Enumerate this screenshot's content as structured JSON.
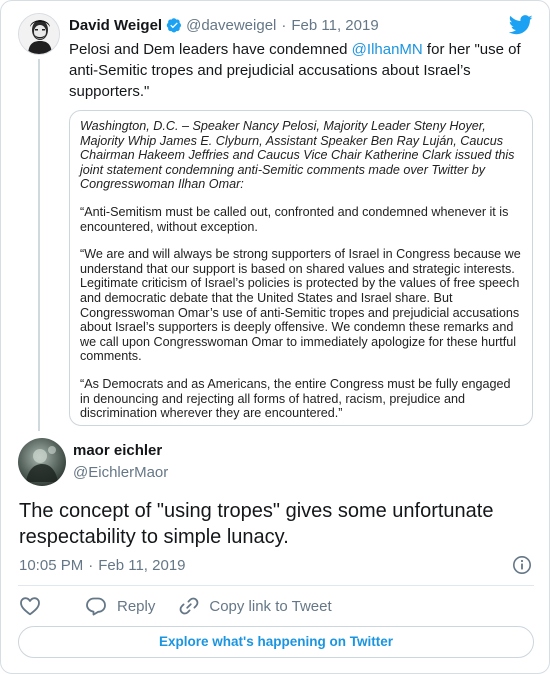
{
  "quoted_tweet": {
    "author_name": "David Weigel",
    "handle": "@daveweigel",
    "separator": "·",
    "date": "Feb 11, 2019",
    "text_before": "Pelosi and Dem leaders have condemned ",
    "mention": "@IlhanMN",
    "text_after": " for her \"use of anti-Semitic tropes and prejudicial accusations about Israel’s supporters.\"",
    "statement": {
      "lead": "Washington, D.C. – Speaker Nancy Pelosi, Majority Leader Steny Hoyer, Majority Whip James E. Clyburn, Assistant Speaker Ben Ray Luján, Caucus Chairman Hakeem Jeffries and Caucus Vice Chair Katherine Clark issued this joint statement condemning anti-Semitic comments made over Twitter by Congresswoman Ilhan Omar:",
      "p1": "“Anti-Semitism must be called out, confronted and condemned whenever it is encountered, without exception.",
      "p2": "“We are and will always be strong supporters of Israel in Congress because we understand that our support is based on shared values and strategic interests. Legitimate criticism of Israel’s policies is protected by the values of free speech and democratic debate that the United States and Israel share.  But Congresswoman Omar’s use of anti-Semitic tropes and prejudicial accusations about Israel’s supporters is deeply offensive.  We condemn these remarks and we call upon Congresswoman Omar to immediately apologize for these hurtful comments.",
      "p3": "“As Democrats and as Americans, the entire Congress must be fully engaged in denouncing and rejecting all forms of hatred, racism, prejudice and discrimination wherever they are encountered.”"
    }
  },
  "main_tweet": {
    "author_name": "maor eichler",
    "handle": "@EichlerMaor",
    "text": "The concept of \"using tropes\" gives some unfortunate respectability to simple lunacy.",
    "time": "10:05 PM",
    "separator": "·",
    "date": "Feb 11, 2019"
  },
  "actions": {
    "like_icon": "heart-icon",
    "reply_label": "Reply",
    "copy_link_label": "Copy link to Tweet"
  },
  "explore_label": "Explore what's happening on Twitter",
  "colors": {
    "accent": "#1b95e0",
    "text_secondary": "#657786",
    "border": "#ccd6dd"
  }
}
